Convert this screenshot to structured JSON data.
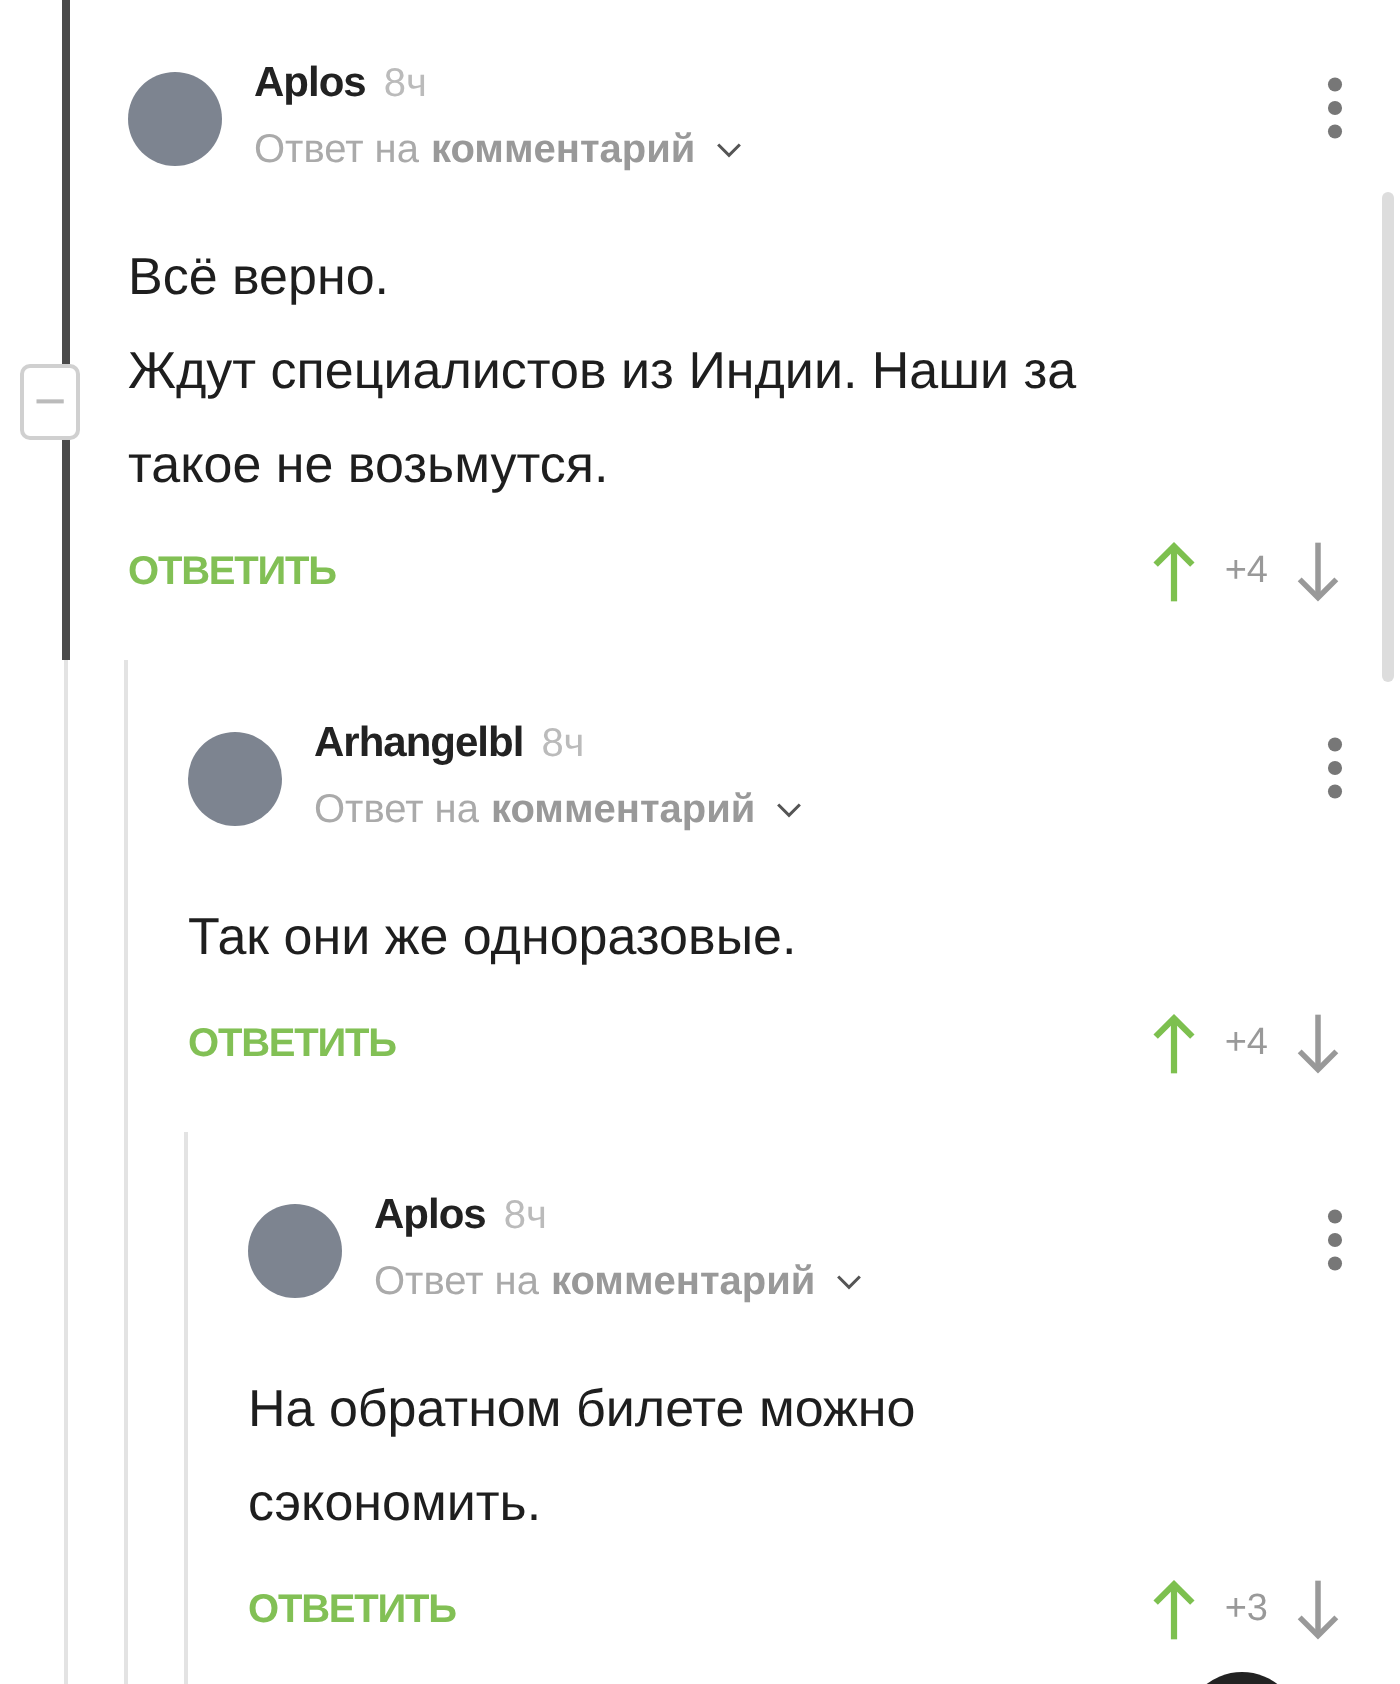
{
  "comments": [
    {
      "author": "Aplos",
      "time": "8ч",
      "reply_prefix": "Ответ на",
      "reply_target": "комментарий",
      "highlighted": true,
      "lines": [
        "Всё верно.",
        "Ждут специалистов из Индии. Наши за такое не возьмутся."
      ],
      "reply_label": "ОТВЕТИТЬ",
      "score": "+4",
      "collapse_label": "−",
      "children": [
        {
          "author": "Arhangelbl",
          "time": "8ч",
          "reply_prefix": "Ответ на",
          "reply_target": "комментарий",
          "highlighted": false,
          "lines": [
            "Так они же одноразовые."
          ],
          "reply_label": "ОТВЕТИТЬ",
          "score": "+4",
          "children": [
            {
              "author": "Aplos",
              "time": "8ч",
              "reply_prefix": "Ответ на",
              "reply_target": "комментарий",
              "highlighted": false,
              "lines": [
                "На обратном билете можно сэкономить."
              ],
              "reply_label": "ОТВЕТИТЬ",
              "score": "+3"
            }
          ]
        }
      ]
    }
  ]
}
